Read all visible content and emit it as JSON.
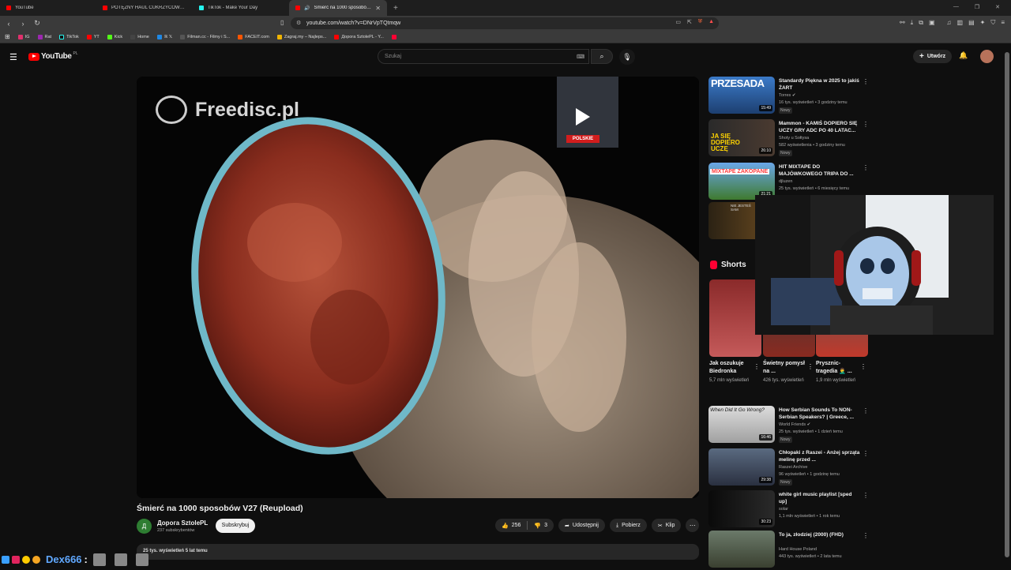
{
  "browser": {
    "tabs": [
      {
        "title": "YouTube",
        "color": "#ff0000"
      },
      {
        "title": "POTĘŻNY HAUL CUKRZYCOWY - ile t",
        "color": "#ff0000"
      },
      {
        "title": "TikTok - Make Your Day",
        "color": "#222222"
      },
      {
        "title": "Śmierć na 1000 sposobów V27",
        "color": "#ff0000"
      }
    ],
    "url": "youtube.com/watch?v=DNrVpTQtmqw",
    "bookmarks": [
      {
        "label": "IG",
        "color": "#e1306c"
      },
      {
        "label": "Rat",
        "color": "#9c27b0"
      },
      {
        "label": "TikTok",
        "color": "#111111"
      },
      {
        "label": "YT",
        "color": "#ff0000"
      },
      {
        "label": "Kick",
        "color": "#53fc18"
      },
      {
        "label": "Home",
        "color": "#444444"
      },
      {
        "label": "ℝ 𝕏",
        "color": "#1e88e5"
      },
      {
        "label": "Filman.cc - Filmy i S...",
        "color": "#555555"
      },
      {
        "label": "FACEIT.com",
        "color": "#ff5500"
      },
      {
        "label": "Zagraj.my – Najleps...",
        "color": "#f0b400"
      },
      {
        "label": "Дорога SztolePL - Y...",
        "color": "#ff0000"
      },
      {
        "label": "",
        "color": "#ff0033"
      }
    ]
  },
  "header": {
    "logo_text": "YouTube",
    "country": "PL",
    "search_placeholder": "Szukaj",
    "create_label": "Utwórz"
  },
  "player": {
    "watermark": "Freedisc.pl",
    "mini_flag": "POLSKIE"
  },
  "video": {
    "title": "Śmierć na 1000 sposobów V27 (Reupload)",
    "channel": "Дорога SztolePL",
    "channel_initial": "Д",
    "subscribers": "237 subskrybentów",
    "subscribe_label": "Subskrybuj",
    "likes": "256",
    "dislikes": "3",
    "share_label": "Udostępnij",
    "download_label": "Pobierz",
    "clip_label": "Klip",
    "description_meta": "25 tys. wyświetleń  5 lat temu"
  },
  "recommendations": [
    {
      "title": "Standardy Piękna w 2025 to jakiś ŻART",
      "channel": "Torres",
      "meta": "16 tys. wyświetleń • 3 godziny temu",
      "badge": "Nowy",
      "duration": "15:49",
      "thumb_text": "PRZESADA"
    },
    {
      "title": "Mammon - KAMIŚ DOPIERO SIĘ UCZY GRY ADC PO 40 LATAC...",
      "channel": "Shoty u Sołtysa",
      "meta": "582 wyświetlenia • 3 godziny temu",
      "badge": "Nowy",
      "duration": "26:10",
      "thumb_text": "JA SIĘ DOPIERO UCZĘ"
    },
    {
      "title": "HIT MIXTAPE DO MAJÓWKOWEGO TRIPA DO ...",
      "channel": "djluzen",
      "meta": "25 tys. wyświetleń • 6 miesięcy temu",
      "badge": "",
      "duration": "21:21",
      "thumb_text": "MIXTAPE ZAKOPANE"
    },
    {
      "title": "",
      "channel": "",
      "meta": "",
      "badge": "",
      "duration": "",
      "thumb_text": "NIE JESTEŚ SAM"
    }
  ],
  "shorts": {
    "heading": "Shorts",
    "items": [
      {
        "title": "Jak oszukuje Biedronka",
        "views": "5,7 mln wyświetleń"
      },
      {
        "title": "Świetny pomysł na ...",
        "views": "426 tys. wyświetleń"
      },
      {
        "title": "Prysznic-tragedia 🤦‍♂️ ...",
        "views": "1,9 mln wyświetleń"
      }
    ]
  },
  "recommendations2": [
    {
      "title": "How Serbian Sounds To NON-Serbian Speakers? | Greece, ...",
      "channel": "World Friends",
      "meta": "25 tys. wyświetleń • 1 dzień temu",
      "badge": "Nowy",
      "duration": "16:46",
      "thumb_text": "When Did It Go Wrong?"
    },
    {
      "title": "Chłopaki z Raszei - Anżej sprząta melinę przed ...",
      "channel": "Raszei Archive",
      "meta": "96 wyświetleń • 1 godzinę temu",
      "badge": "Nowy",
      "duration": "29:38",
      "thumb_text": ""
    },
    {
      "title": "white girl music playlist [sped up]",
      "channel": "solar",
      "meta": "1,1 mln wyświetleń • 1 rok temu",
      "badge": "",
      "duration": "30:23",
      "thumb_text": ""
    },
    {
      "title": "To ja, złodziej (2000) (FHD)",
      "channel": "Hard House Poland",
      "meta": "443 tys. wyświetleń • 2 lata temu",
      "badge": "",
      "duration": "",
      "thumb_text": ""
    }
  ],
  "overlay": {
    "username": "Dex666",
    "colon": ":"
  }
}
